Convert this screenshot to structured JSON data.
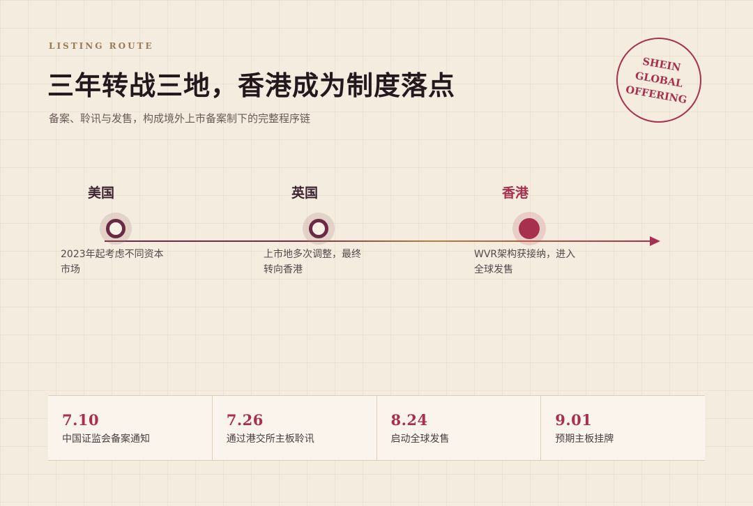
{
  "header": {
    "eyebrow": "LISTING ROUTE",
    "title": "三年转战三地，香港成为制度落点",
    "subtitle": "备案、聆讯与发售，构成境外上市备案制下的完整程序链"
  },
  "stamp": {
    "lines": [
      "SHEIN",
      "GLOBAL",
      "OFFERING"
    ],
    "color": "#a8304f"
  },
  "timeline": {
    "stops": [
      {
        "label": "美国",
        "desc_line1": "2023年起考虑不同资本",
        "desc_line2": "市场",
        "active": false
      },
      {
        "label": "英国",
        "desc_line1": "上市地多次调整，最终",
        "desc_line2": "转向香港",
        "active": false
      },
      {
        "label": "香港",
        "desc_line1": "WVR架构获接纳，进入",
        "desc_line2": "全球发售",
        "active": true
      }
    ],
    "accent": "#a8304f",
    "node_color": "#6b2a43"
  },
  "milestones": [
    {
      "date": "7.10",
      "text": "中国证监会备案通知"
    },
    {
      "date": "7.26",
      "text": "通过港交所主板聆讯"
    },
    {
      "date": "8.24",
      "text": "启动全球发售"
    },
    {
      "date": "9.01",
      "text": "预期主板挂牌"
    }
  ]
}
